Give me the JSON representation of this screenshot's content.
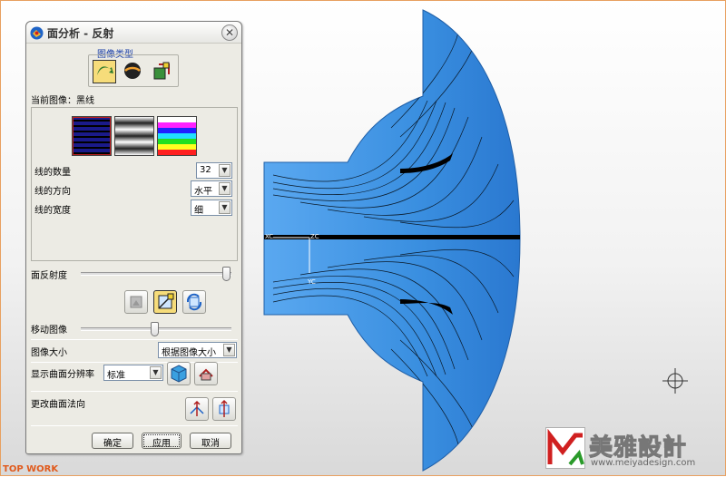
{
  "dialog": {
    "title": "面分析 - 反射",
    "close_label": "✕",
    "image_type_group": "图像类型",
    "current_image": "当前图像：黑线",
    "line_count_label": "线的数量",
    "line_count_value": "32",
    "line_direction_label": "线的方向",
    "line_direction_value": "水平",
    "line_width_label": "线的宽度",
    "line_width_value": "细",
    "reflectivity_label": "面反射度",
    "move_image_label": "移动图像",
    "image_size_label": "图像大小",
    "image_size_value": "根据图像大小",
    "display_resolution_label": "显示曲面分辨率",
    "display_resolution_value": "标准",
    "change_normal_label": "更改曲面法向",
    "ok_label": "确定",
    "apply_label": "应用",
    "cancel_label": "取消"
  },
  "viewport": {
    "axis_labels": [
      "XC",
      "ZC",
      "YC"
    ],
    "surface_color": "#3a8fe0"
  },
  "footer": {
    "brand": "TOP WORK"
  },
  "watermark": {
    "title": "美雅設計",
    "url": "www.meiyadesign.com"
  },
  "colors": {
    "accent": "#1a3fa8",
    "brand": "#e05a1c",
    "selected": "#f6dc7a"
  }
}
